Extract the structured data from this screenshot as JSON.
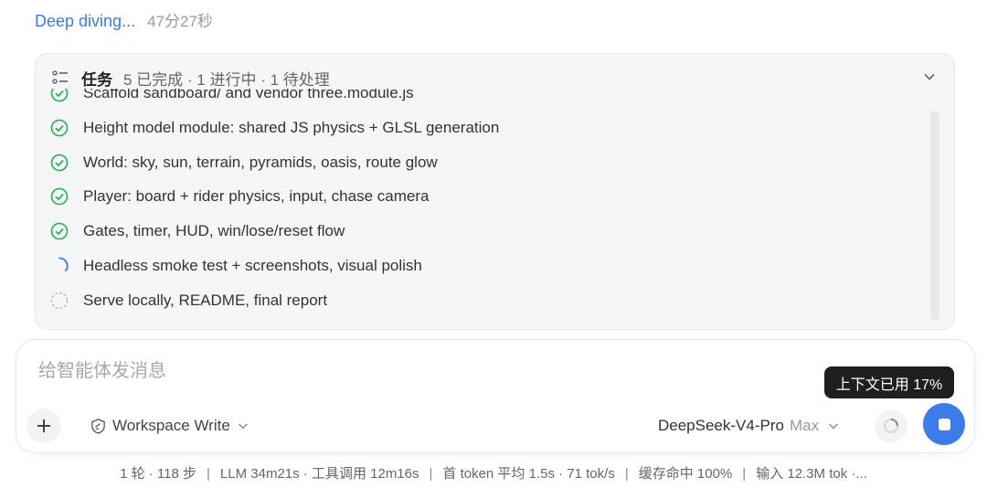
{
  "status": {
    "title": "Deep diving...",
    "elapsed": "47分27秒"
  },
  "tasks": {
    "header_title": "任务",
    "summary": "5 已完成 · 1 进行中 · 1 待处理",
    "items": [
      {
        "label": "Scaffold sandboard/ and vendor three.module.js",
        "state": "done"
      },
      {
        "label": "Height model module: shared JS physics + GLSL generation",
        "state": "done"
      },
      {
        "label": "World: sky, sun, terrain, pyramids, oasis, route glow",
        "state": "done"
      },
      {
        "label": "Player: board + rider physics, input, chase camera",
        "state": "done"
      },
      {
        "label": "Gates, timer, HUD, win/lose/reset flow",
        "state": "done"
      },
      {
        "label": "Headless smoke test + screenshots, visual polish",
        "state": "in-progress"
      },
      {
        "label": "Serve locally, README, final report",
        "state": "pending"
      }
    ]
  },
  "composer": {
    "placeholder": "给智能体发消息",
    "workspace_label": "Workspace Write",
    "model_name": "DeepSeek-V4-Pro",
    "model_tier": "Max"
  },
  "tooltip": {
    "text": "上下文已用 17%"
  },
  "stats": {
    "turns": "1 轮 · 118 步",
    "llm": "LLM 34m21s · 工具调用 12m16s",
    "first_token": "首 token 平均 1.5s · 71 tok/s",
    "cache": "缓存命中 100%",
    "input": "输入 12.3M tok ·..."
  },
  "colors": {
    "accent": "#3c7be8",
    "done": "#22b24c",
    "in_progress": "#3b7be5",
    "pending": "#b0b0b0"
  },
  "icons": {
    "done": "check-circle-icon",
    "in_progress": "spinner-icon",
    "pending": "dashed-circle-icon"
  }
}
